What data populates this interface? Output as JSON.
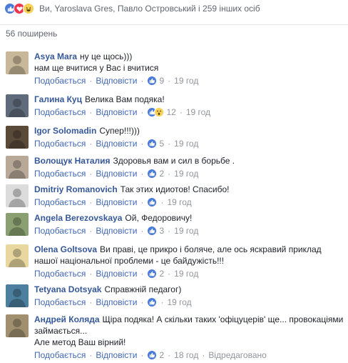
{
  "reactions": {
    "summary": "Ви, Yaroslava Gres, Павло Островський і 259 інших осіб",
    "icons": [
      "like-icon",
      "love-icon",
      "haha-icon"
    ]
  },
  "shares": {
    "label": "56 поширень"
  },
  "actions": {
    "like": "Подобається",
    "reply": "Відповісти"
  },
  "comments": [
    {
      "name": "Asya Mara",
      "text": "ну це щось)))\nнам ще вчитися у Вас і вчитися",
      "reactions": "9",
      "time": "19 год",
      "avatar_color": "#c8b89a"
    },
    {
      "name": "Галина Куц",
      "text": "Велика Вам подяка!",
      "reactions": "12",
      "time": "19 год",
      "avatar_color": "#5f6b7a",
      "wow": true
    },
    {
      "name": "Igor Solomadin",
      "text": "Супер!!!)))",
      "reactions": "5",
      "time": "19 год",
      "avatar_color": "#5a4a3a"
    },
    {
      "name": "Волощук Наталия",
      "text": "Здоровья вам и сил в борьбе .",
      "reactions": "2",
      "time": "19 год",
      "avatar_color": "#b8a898"
    },
    {
      "name": "Dmitriy Romanovich",
      "text": "Так этих идиотов! Спасибо!",
      "reactions": "",
      "time": "19 год",
      "avatar_color": "#dcdcdc"
    },
    {
      "name": "Angela Berezovskaya",
      "text": "Ой, Федоровичу!",
      "reactions": "3",
      "time": "19 год",
      "avatar_color": "#8aa070"
    },
    {
      "name": "Olena Goltsova",
      "text": "Ви праві, це прикро і боляче, але ось яскравий приклад нашої національної проблеми - це байдужість!!!",
      "reactions": "2",
      "time": "19 год",
      "avatar_color": "#e8d8a0"
    },
    {
      "name": "Tetyana Dotsyak",
      "text": "Справжній педагог)",
      "reactions": "",
      "time": "19 год",
      "avatar_color": "#4d7f9e"
    },
    {
      "name": "Андрей Коляда",
      "text": "Щіра подяка! А скільки таких 'офіцуцерів' ще... провокаціями займається...\nАле метод Ваш вірний!",
      "reactions": "2",
      "time": "18 год",
      "edited": "Відредаговано",
      "avatar_color": "#a09070"
    }
  ]
}
